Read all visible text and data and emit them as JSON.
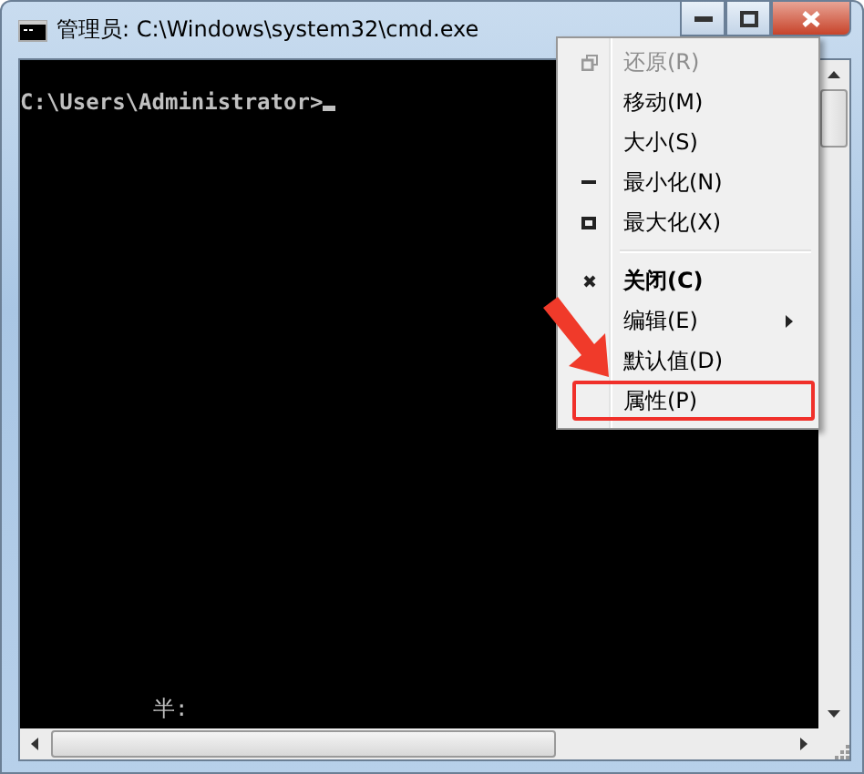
{
  "window": {
    "title": "管理员: C:\\Windows\\system32\\cmd.exe"
  },
  "console": {
    "lines": [
      "C:\\Users\\Administrator>"
    ],
    "cursor": true,
    "ime_status": "半:"
  },
  "system_menu": {
    "items": [
      {
        "kind": "restore",
        "label": "还原(R)",
        "disabled": true,
        "bold": false,
        "highlighted": false
      },
      {
        "kind": "plain",
        "label": "移动(M)",
        "disabled": false,
        "bold": false,
        "highlighted": false
      },
      {
        "kind": "plain",
        "label": "大小(S)",
        "disabled": false,
        "bold": false,
        "highlighted": false
      },
      {
        "kind": "minimize",
        "label": "最小化(N)",
        "disabled": false,
        "bold": false,
        "highlighted": false
      },
      {
        "kind": "maximize",
        "label": "最大化(X)",
        "disabled": false,
        "bold": false,
        "highlighted": false
      },
      {
        "kind": "separator"
      },
      {
        "kind": "close",
        "label": "关闭(C)",
        "disabled": false,
        "bold": true,
        "highlighted": false
      },
      {
        "kind": "submenu",
        "label": "编辑(E)",
        "disabled": false,
        "bold": false,
        "highlighted": false
      },
      {
        "kind": "plain",
        "label": "默认值(D)",
        "disabled": false,
        "bold": false,
        "highlighted": false
      },
      {
        "kind": "plain",
        "label": "属性(P)",
        "disabled": false,
        "bold": false,
        "highlighted": true
      }
    ]
  }
}
